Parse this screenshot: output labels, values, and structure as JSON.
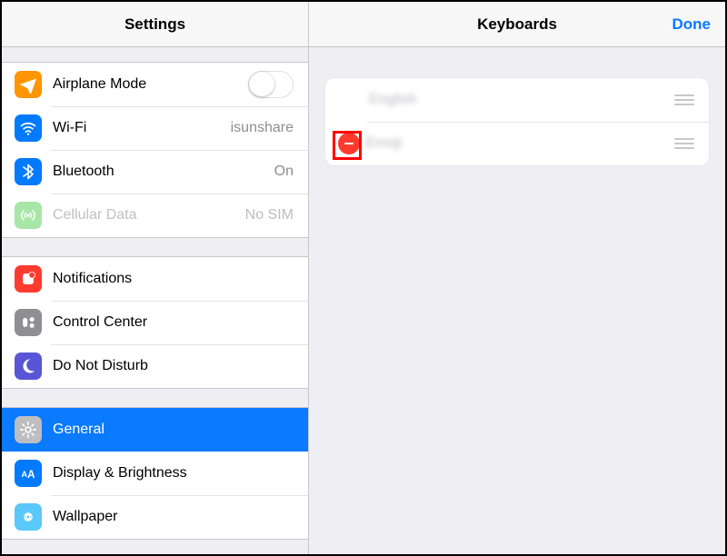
{
  "sidebar": {
    "title": "Settings",
    "groups": [
      {
        "rows": [
          {
            "key": "airplane",
            "label": "Airplane Mode",
            "control": "toggle",
            "value": "off"
          },
          {
            "key": "wifi",
            "label": "Wi-Fi",
            "value": "isunshare"
          },
          {
            "key": "bluetooth",
            "label": "Bluetooth",
            "value": "On"
          },
          {
            "key": "cellular",
            "label": "Cellular Data",
            "value": "No SIM",
            "disabled": true
          }
        ]
      },
      {
        "rows": [
          {
            "key": "notifications",
            "label": "Notifications"
          },
          {
            "key": "controlcenter",
            "label": "Control Center"
          },
          {
            "key": "dnd",
            "label": "Do Not Disturb"
          }
        ]
      },
      {
        "rows": [
          {
            "key": "general",
            "label": "General",
            "selected": true
          },
          {
            "key": "display",
            "label": "Display & Brightness"
          },
          {
            "key": "wallpaper",
            "label": "Wallpaper"
          }
        ]
      }
    ]
  },
  "detail": {
    "title": "Keyboards",
    "done_label": "Done",
    "keyboards": [
      {
        "name": "English",
        "show_delete": false
      },
      {
        "name": "Emoji",
        "show_delete": true,
        "highlighted": true
      }
    ]
  }
}
